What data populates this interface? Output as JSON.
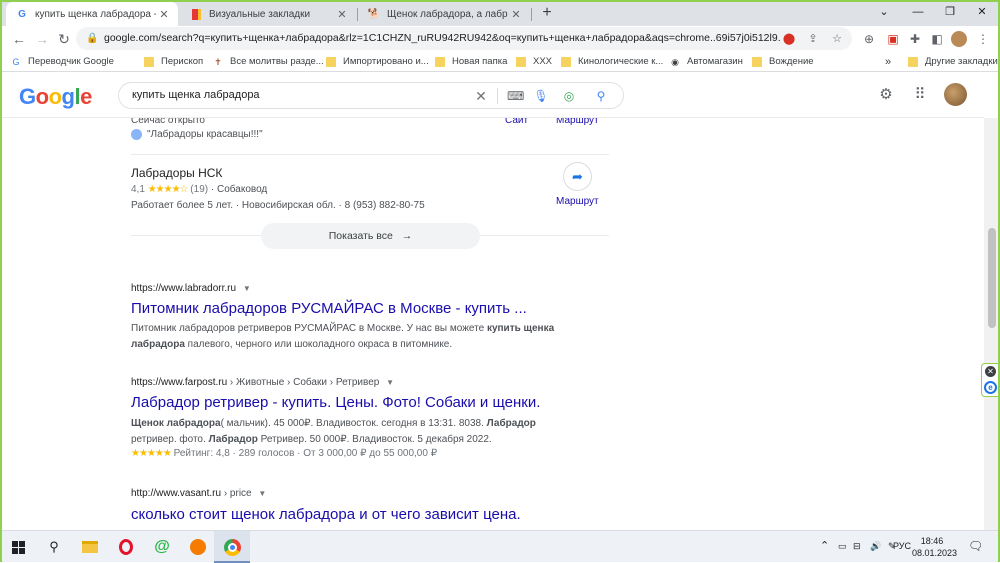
{
  "browser": {
    "tabs": [
      {
        "title": "купить щенка лабрадора - Поиск",
        "active": true
      },
      {
        "title": "Визуальные закладки",
        "active": false
      },
      {
        "title": "Щенок лабрадора, а лабрадор",
        "active": false
      }
    ],
    "url": "google.com/search?q=купить+щенка+лабрадора&rlz=1C1CHZN_ruRU942RU942&oq=купить+щенка+лабрадора&aqs=chrome..69i57j0i512l9.1..."
  },
  "bookmarks": [
    {
      "label": "Переводчик Google",
      "icon": "translate-icon"
    },
    {
      "label": "Перископ",
      "icon": "folder-icon"
    },
    {
      "label": "Все молитвы разде...",
      "icon": "cross-icon"
    },
    {
      "label": "Импортировано и...",
      "icon": "folder-icon"
    },
    {
      "label": "Новая папка",
      "icon": "folder-icon"
    },
    {
      "label": "ХХХ",
      "icon": "folder-icon"
    },
    {
      "label": "Кинологические к...",
      "icon": "folder-icon"
    },
    {
      "label": "Автомагазин",
      "icon": "globe-icon"
    },
    {
      "label": "Вождение",
      "icon": "folder-icon"
    }
  ],
  "bookmarks_overflow": "»",
  "bookmarks_other": "Другие закладки",
  "google": {
    "logo": "Google",
    "query": "купить щенка лабрадора"
  },
  "local": {
    "open_now": "Сейчас открыто",
    "site_label": "Сайт",
    "route_label": "Маршрут",
    "review": "\"Лабрадоры красавцы!!!\"",
    "place_name": "Лабрадоры НСК",
    "rating": "4,1",
    "stars": "★★★★☆",
    "reviews": "(19)",
    "category": "· Собаковод",
    "info": "Работает более 5 лет. · Новосибирская обл. · 8 (953) 882-80-75",
    "route_label2": "Маршрут",
    "show_all": "Показать все"
  },
  "results": [
    {
      "url": "https://www.labradorr.ru",
      "crumbs": "",
      "title": "Питомник лабрадоров РУСМАЙРАС в Москве - купить ...",
      "snippet_html": "Питомник лабрадоров ретриверов РУСМАЙРАС в Москве. У нас вы можете <b>купить щенка лабрадора</b> палевого, черного или шоколадного окраса в питомнике."
    },
    {
      "url": "https://www.farpost.ru",
      "crumbs": " › Животные › Собаки › Ретривер",
      "title": "Лабрадор ретривер - купить. Цены. Фото! Собаки и щенки.",
      "snippet_html": "<b>Щенок лабрадора</b>( мальчик). 45 000₽. Владивосток. сегодня в 13:31. 8038. <b>Лабрадор</b> ретривер. фото. <b>Лабрадор</b> Ретривер. 50 000₽. Владивосток. 5 декабря 2022.",
      "rating_stars": "★★★★★",
      "rating_text": "Рейтинг: 4,8 · 289 голосов · От 3 000,00 ₽ до 55 000,00 ₽"
    },
    {
      "url": "http://www.vasant.ru",
      "crumbs": " › price",
      "title": "сколько стоит щенок лабрадора и от чего зависит цена."
    }
  ],
  "taskbar": {
    "lang": "РУС",
    "time": "18:46",
    "date": "08.01.2023"
  },
  "colors": {
    "link": "#1a0dab",
    "accent": "#1a73e8",
    "star": "#fbbc04",
    "frame": "#8fd14f"
  }
}
